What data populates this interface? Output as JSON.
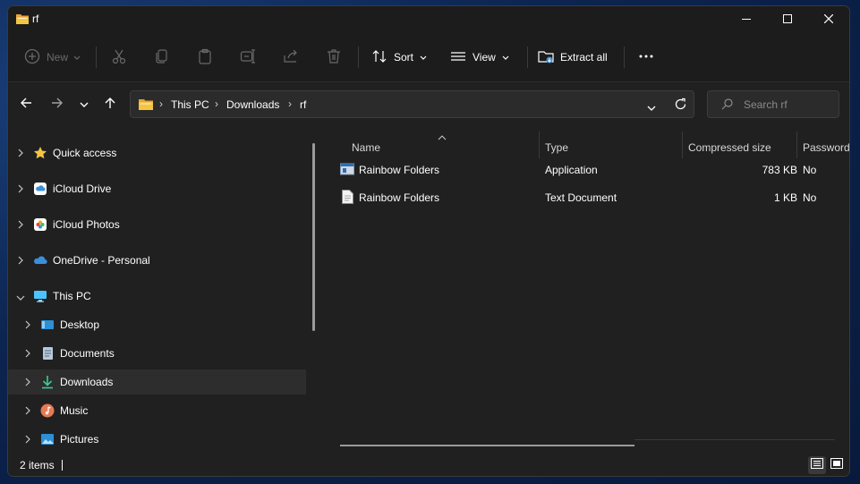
{
  "window": {
    "title": "rf",
    "controls": {
      "minimize": "minimize",
      "maximize": "maximize",
      "close": "close"
    }
  },
  "toolbar": {
    "new_label": "New",
    "sort_label": "Sort",
    "view_label": "View",
    "extract_label": "Extract all"
  },
  "address": {
    "crumbs": [
      "This PC",
      "Downloads",
      "rf"
    ]
  },
  "search": {
    "placeholder": "Search rf"
  },
  "nav": {
    "items": [
      {
        "label": "Quick access"
      },
      {
        "label": "iCloud Drive"
      },
      {
        "label": "iCloud Photos"
      },
      {
        "label": "OneDrive - Personal"
      },
      {
        "label": "This PC"
      },
      {
        "label": "Desktop"
      },
      {
        "label": "Documents"
      },
      {
        "label": "Downloads"
      },
      {
        "label": "Music"
      },
      {
        "label": "Pictures"
      }
    ]
  },
  "columns": [
    "Name",
    "Type",
    "Compressed size",
    "Password"
  ],
  "files": [
    {
      "name": "Rainbow Folders",
      "type": "Application",
      "size": "783 KB",
      "password": "No"
    },
    {
      "name": "Rainbow Folders",
      "type": "Text Document",
      "size": "1 KB",
      "password": "No"
    }
  ],
  "status": {
    "items_count": "2 items"
  },
  "colors": {
    "window_bg": "#202020",
    "titlebar_bg": "#1c1c1c",
    "selected_bg": "#2d2d2d",
    "folder_yellow": "#f4c443",
    "accent_blue": "#3b8fd9"
  }
}
